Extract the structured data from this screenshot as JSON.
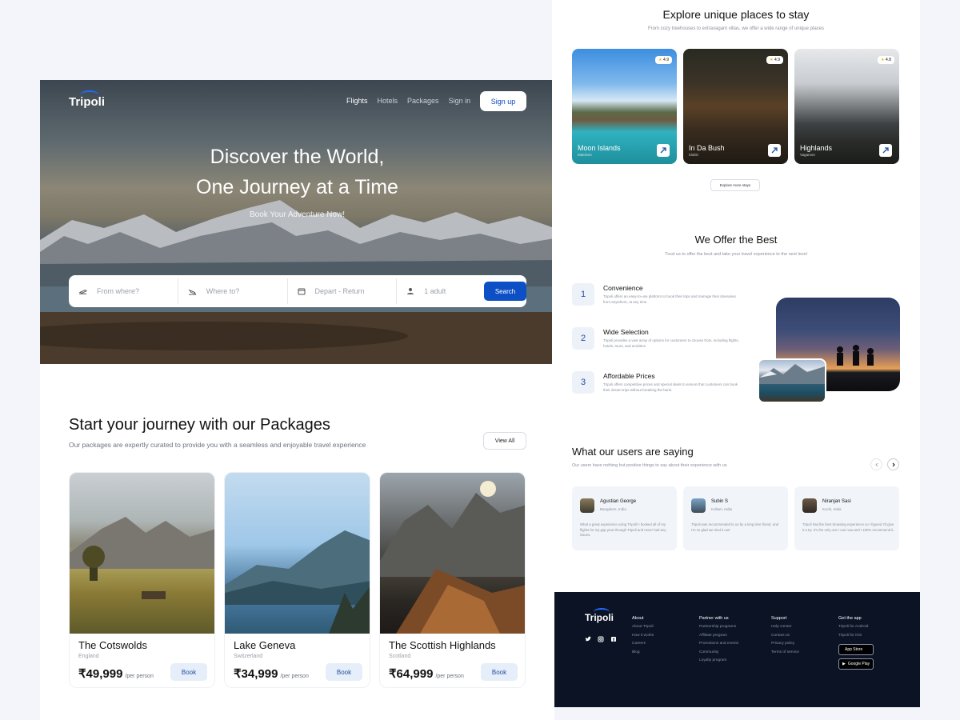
{
  "hero": {
    "logo": "Tripoli",
    "nav": [
      "Flights",
      "Hotels",
      "Packages",
      "Sign in"
    ],
    "signup": "Sign up",
    "title_line1": "Discover the World,",
    "title_line2": "One Journey at a Time",
    "subtitle": "Book Your Adventure Now!",
    "search": {
      "from": "From where?",
      "to": "Where to?",
      "dates": "Depart - Return",
      "guests": "1 adult",
      "button": "Search"
    }
  },
  "packages": {
    "title": "Start your journey with our Packages",
    "subtitle": "Our packages are expertly curated to provide you with a seamless and enjoyable travel experience",
    "view_all": "View All",
    "items": [
      {
        "name": "The Cotswolds",
        "country": "England",
        "price": "₹49,999",
        "per": "/per person",
        "book": "Book"
      },
      {
        "name": "Lake Geneva",
        "country": "Switzerland",
        "price": "₹34,999",
        "per": "/per person",
        "book": "Book"
      },
      {
        "name": "The Scottish Highlands",
        "country": "Scotland",
        "price": "₹64,999",
        "per": "/per person",
        "book": "Book"
      }
    ]
  },
  "stays": {
    "title": "Explore unique places to stay",
    "subtitle": "From cozy treehouses to extravagant villas, we offer a wide range of unique places",
    "items": [
      {
        "name": "Moon Islands",
        "location": "Maldives",
        "rating": "4.9"
      },
      {
        "name": "In Da Bush",
        "location": "Idukki",
        "rating": "4.9"
      },
      {
        "name": "Highlands",
        "location": "Vagamon",
        "rating": "4.8"
      }
    ],
    "more": "Explore more stays"
  },
  "offer": {
    "title": "We Offer the Best",
    "subtitle": "Trust us to offer the best and take your travel experience to the next level",
    "items": [
      {
        "num": "1",
        "title": "Convenience",
        "desc": "Tripoli offers an easy-to-use platform to book their trips and manage their itineraries from anywhere, at any time."
      },
      {
        "num": "2",
        "title": "Wide Selection",
        "desc": "Tripoli provides a vast array of options for customers to choose from, including flights, hotels, tours, and activities"
      },
      {
        "num": "3",
        "title": "Affordable Prices",
        "desc": "Tripoli offers competitive prices and special deals to ensure that customers can book their dream trips without breaking the bank."
      }
    ]
  },
  "reviews": {
    "title": "What our users are saying",
    "subtitle": "Our users have nothing but positive things to say about their experience with us",
    "items": [
      {
        "name": "Agustian George",
        "location": "Bangalore, India",
        "text": "What a great experience using Tripoli! I booked all of my flights for my gap year through Tripoli and never had any issues."
      },
      {
        "name": "Subin S",
        "location": "Kollam, India",
        "text": "Tripoli was recommended to us by a long time friend, and I'm so glad we tried it out!"
      },
      {
        "name": "Niranjan Sasi",
        "location": "Kochi, India",
        "text": "Tripoli had the best browsing experience so I figured I'd give it a try. It's the only one I use now and I 100% recommend it."
      }
    ]
  },
  "footer": {
    "logo": "Tripoli",
    "about": {
      "heading": "About",
      "items": [
        "About Tripoli",
        "How it works",
        "Careers",
        "Blog"
      ]
    },
    "partner": {
      "heading": "Partner with us",
      "items": [
        "Partnership programs",
        "Affiliate program",
        "Promotions and events",
        "Community",
        "Loyalty program"
      ]
    },
    "support": {
      "heading": "Support",
      "items": [
        "Help Center",
        "Contact us",
        "Privacy policy",
        "Terms of service"
      ]
    },
    "app": {
      "heading": "Get the app",
      "items": [
        "Tripoli for Android",
        "Tripoli for iOS"
      ],
      "app_store": "App Store",
      "google_play": "Google Play"
    }
  },
  "colors": {
    "primary": "#0d4fc4",
    "footer_bg": "#0b1325",
    "accent_light": "#e6eef9"
  }
}
